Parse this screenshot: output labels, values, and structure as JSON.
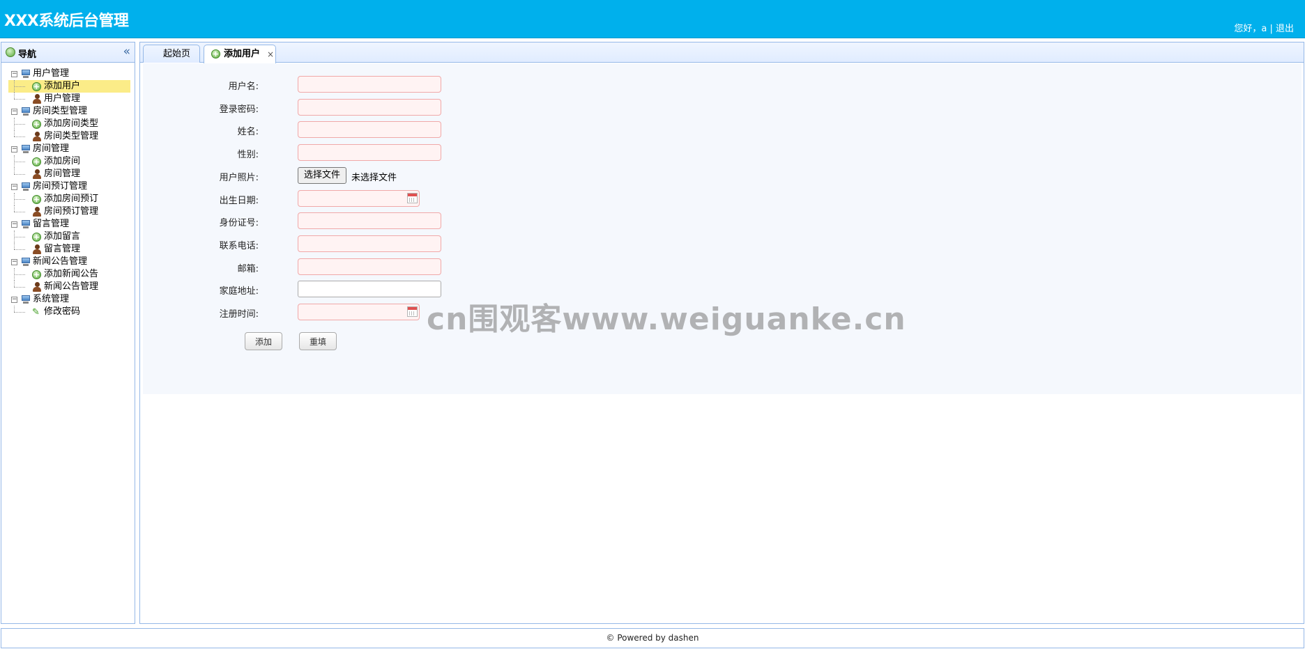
{
  "header": {
    "title": "XXX系统后台管理",
    "greeting": "您好，a",
    "separator": "|",
    "logout": "退出"
  },
  "west": {
    "title": "导航",
    "collapse_glyph": "«"
  },
  "tree": [
    {
      "label": "用户管理",
      "children": [
        {
          "label": "添加用户",
          "icon": "add-icon",
          "selected": true
        },
        {
          "label": "用户管理",
          "icon": "user-icon"
        }
      ]
    },
    {
      "label": "房间类型管理",
      "children": [
        {
          "label": "添加房间类型",
          "icon": "add-icon"
        },
        {
          "label": "房间类型管理",
          "icon": "user-icon"
        }
      ]
    },
    {
      "label": "房间管理",
      "children": [
        {
          "label": "添加房间",
          "icon": "add-icon"
        },
        {
          "label": "房间管理",
          "icon": "user-icon"
        }
      ]
    },
    {
      "label": "房间预订管理",
      "children": [
        {
          "label": "添加房间预订",
          "icon": "add-icon"
        },
        {
          "label": "房间预订管理",
          "icon": "user-icon"
        }
      ]
    },
    {
      "label": "留言管理",
      "children": [
        {
          "label": "添加留言",
          "icon": "add-icon"
        },
        {
          "label": "留言管理",
          "icon": "user-icon"
        }
      ]
    },
    {
      "label": "新闻公告管理",
      "children": [
        {
          "label": "添加新闻公告",
          "icon": "add-icon"
        },
        {
          "label": "新闻公告管理",
          "icon": "user-icon"
        }
      ]
    },
    {
      "label": "系统管理",
      "children": [
        {
          "label": "修改密码",
          "icon": "pencil-icon"
        }
      ]
    }
  ],
  "tabs": {
    "home": "起始页",
    "active": "添加用户",
    "close": "×"
  },
  "form": {
    "fields": [
      {
        "label": "用户名:",
        "type": "text"
      },
      {
        "label": "登录密码:",
        "type": "text"
      },
      {
        "label": "姓名:",
        "type": "text"
      },
      {
        "label": "性别:",
        "type": "text"
      },
      {
        "label": "用户照片:",
        "type": "file"
      },
      {
        "label": "出生日期:",
        "type": "date"
      },
      {
        "label": "身份证号:",
        "type": "text"
      },
      {
        "label": "联系电话:",
        "type": "text"
      },
      {
        "label": "邮箱:",
        "type": "text"
      },
      {
        "label": "家庭地址:",
        "type": "normal"
      },
      {
        "label": "注册时间:",
        "type": "date"
      }
    ],
    "file_button": "选择文件",
    "file_status": "未选择文件",
    "submit": "添加",
    "reset": "重填"
  },
  "footer": {
    "text": "© Powered by dashen"
  },
  "watermark": "cn围观客www.weiguanke.cn"
}
